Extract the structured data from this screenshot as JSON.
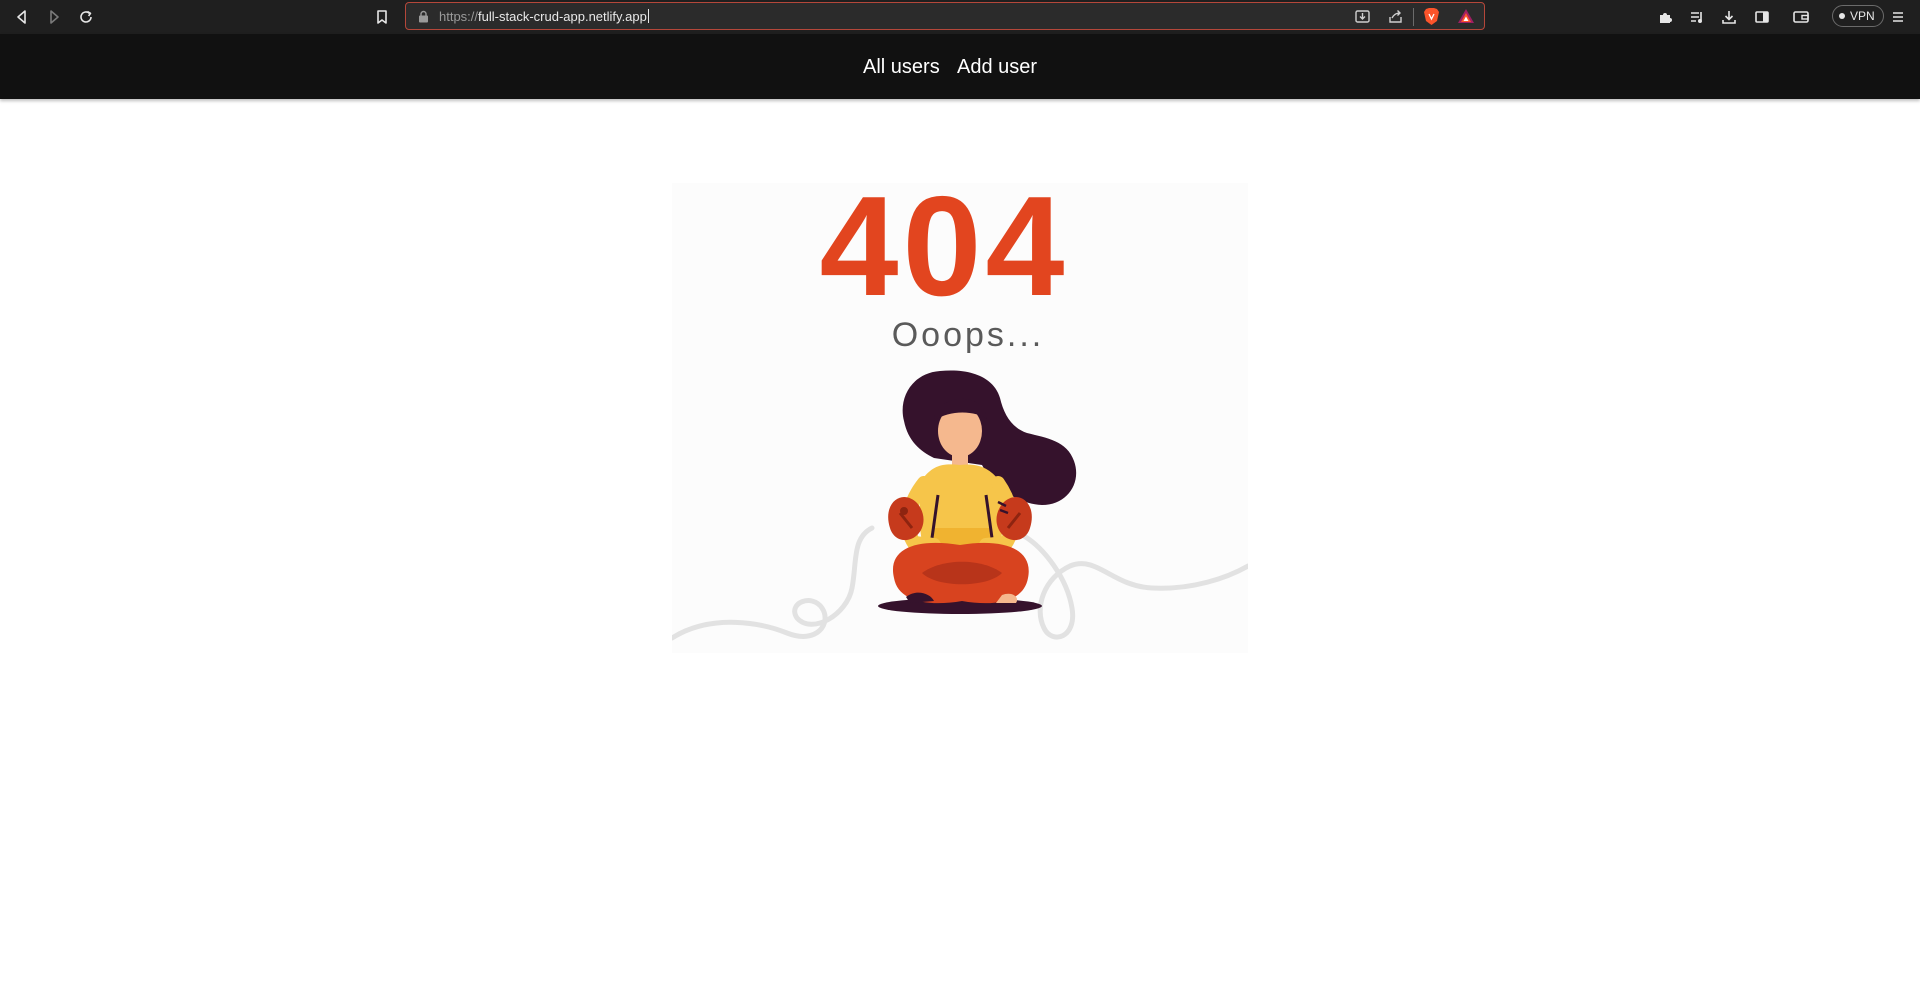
{
  "browser": {
    "url_scheme": "https://",
    "url_host": "full-stack-crud-app.netlify.app",
    "vpn_label": "VPN",
    "icons": {
      "back": "back-arrow-icon",
      "forward": "forward-arrow-icon",
      "reload": "reload-icon",
      "bookmark": "bookmark-icon",
      "lock": "lock-icon",
      "install": "install-app-icon",
      "share": "share-icon",
      "brave_shield": "brave-shield-icon",
      "brave_rewards": "brave-rewards-icon",
      "extensions": "puzzle-icon",
      "playlist": "playlist-icon",
      "downloads": "download-icon",
      "sidebar": "sidebar-icon",
      "wallet": "wallet-icon",
      "menu": "hamburger-menu-icon"
    },
    "colors": {
      "address_border": "#b5473a",
      "brave_orange": "#fb542b"
    }
  },
  "nav": {
    "all_users_label": "All users",
    "add_user_label": "Add user"
  },
  "error_page": {
    "code": "404",
    "message": "Ooops...",
    "colors": {
      "code": "#e2451f",
      "message": "#5a5a5a",
      "hair": "#35122c",
      "shirt": "#f6c54a",
      "pants": "#d8431f",
      "skin": "#f5b88e",
      "cable": "#e2e2e2"
    }
  }
}
